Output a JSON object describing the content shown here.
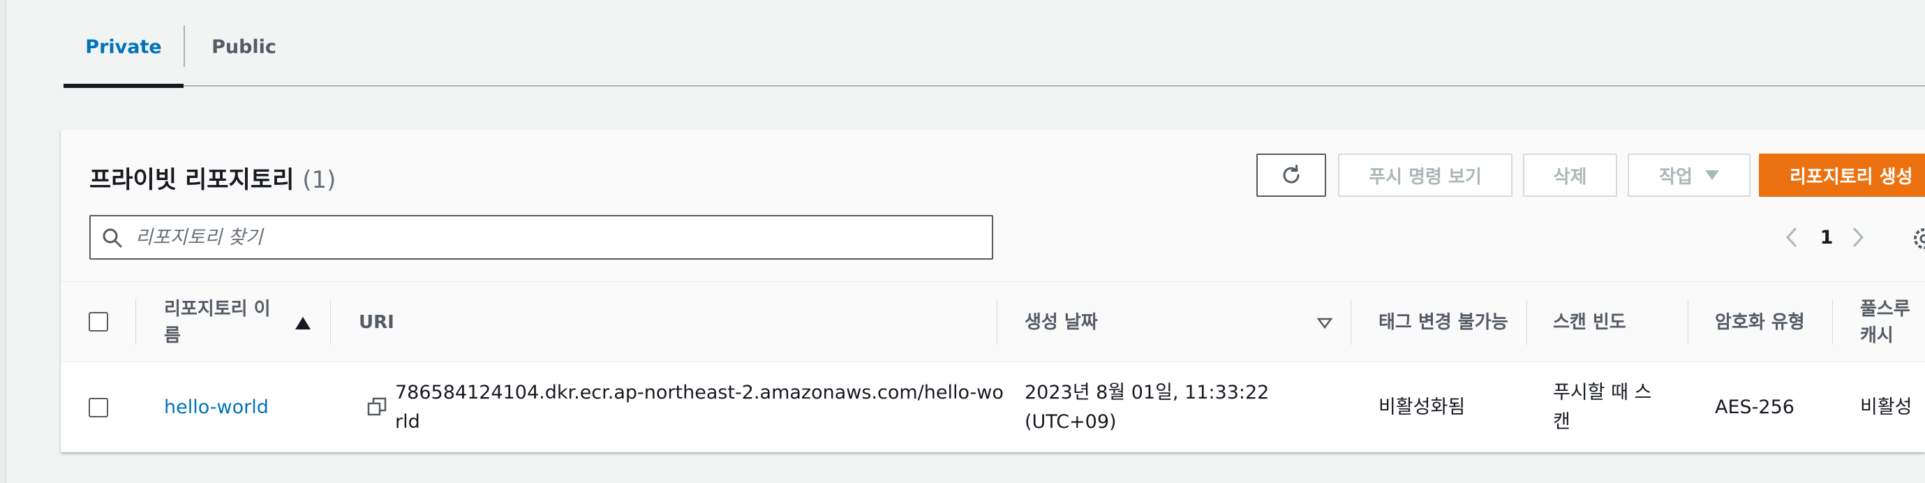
{
  "tabs": {
    "private_label": "Private",
    "public_label": "Public"
  },
  "panel": {
    "title": "프라이빗 리포지토리",
    "count": "(1)"
  },
  "toolbar": {
    "refresh_icon": "refresh-icon",
    "push_label": "푸시 명령 보기",
    "delete_label": "삭제",
    "actions_label": "작업",
    "create_label": "리포지토리 생성"
  },
  "search": {
    "placeholder": "리포지토리 찾기",
    "value": ""
  },
  "pagination": {
    "current_page": "1"
  },
  "table": {
    "columns": {
      "name": "리포지토리 이름",
      "uri": "URI",
      "created": "생성 날짜",
      "tag_immutability": "태그 변경 불가능",
      "scan": "스캔 빈도",
      "encryption": "암호화 유형",
      "pull_through": "풀스루 캐시"
    },
    "sort": {
      "name": "ascending",
      "created": "descending"
    },
    "rows": [
      {
        "name": "hello-world",
        "uri": "786584124104.dkr.ecr.ap-northeast-2.amazonaws.com/hello-world",
        "created": "2023년 8월 01일, 11:33:22 (UTC+09)",
        "tag_immutability": "비활성화됨",
        "scan": "푸시할 때 스캔",
        "encryption": "AES-256",
        "pull_through": "비활성"
      }
    ]
  },
  "colors": {
    "link": "#0073bb",
    "primary_button": "#ec7211",
    "background": "#f2f3f3"
  }
}
